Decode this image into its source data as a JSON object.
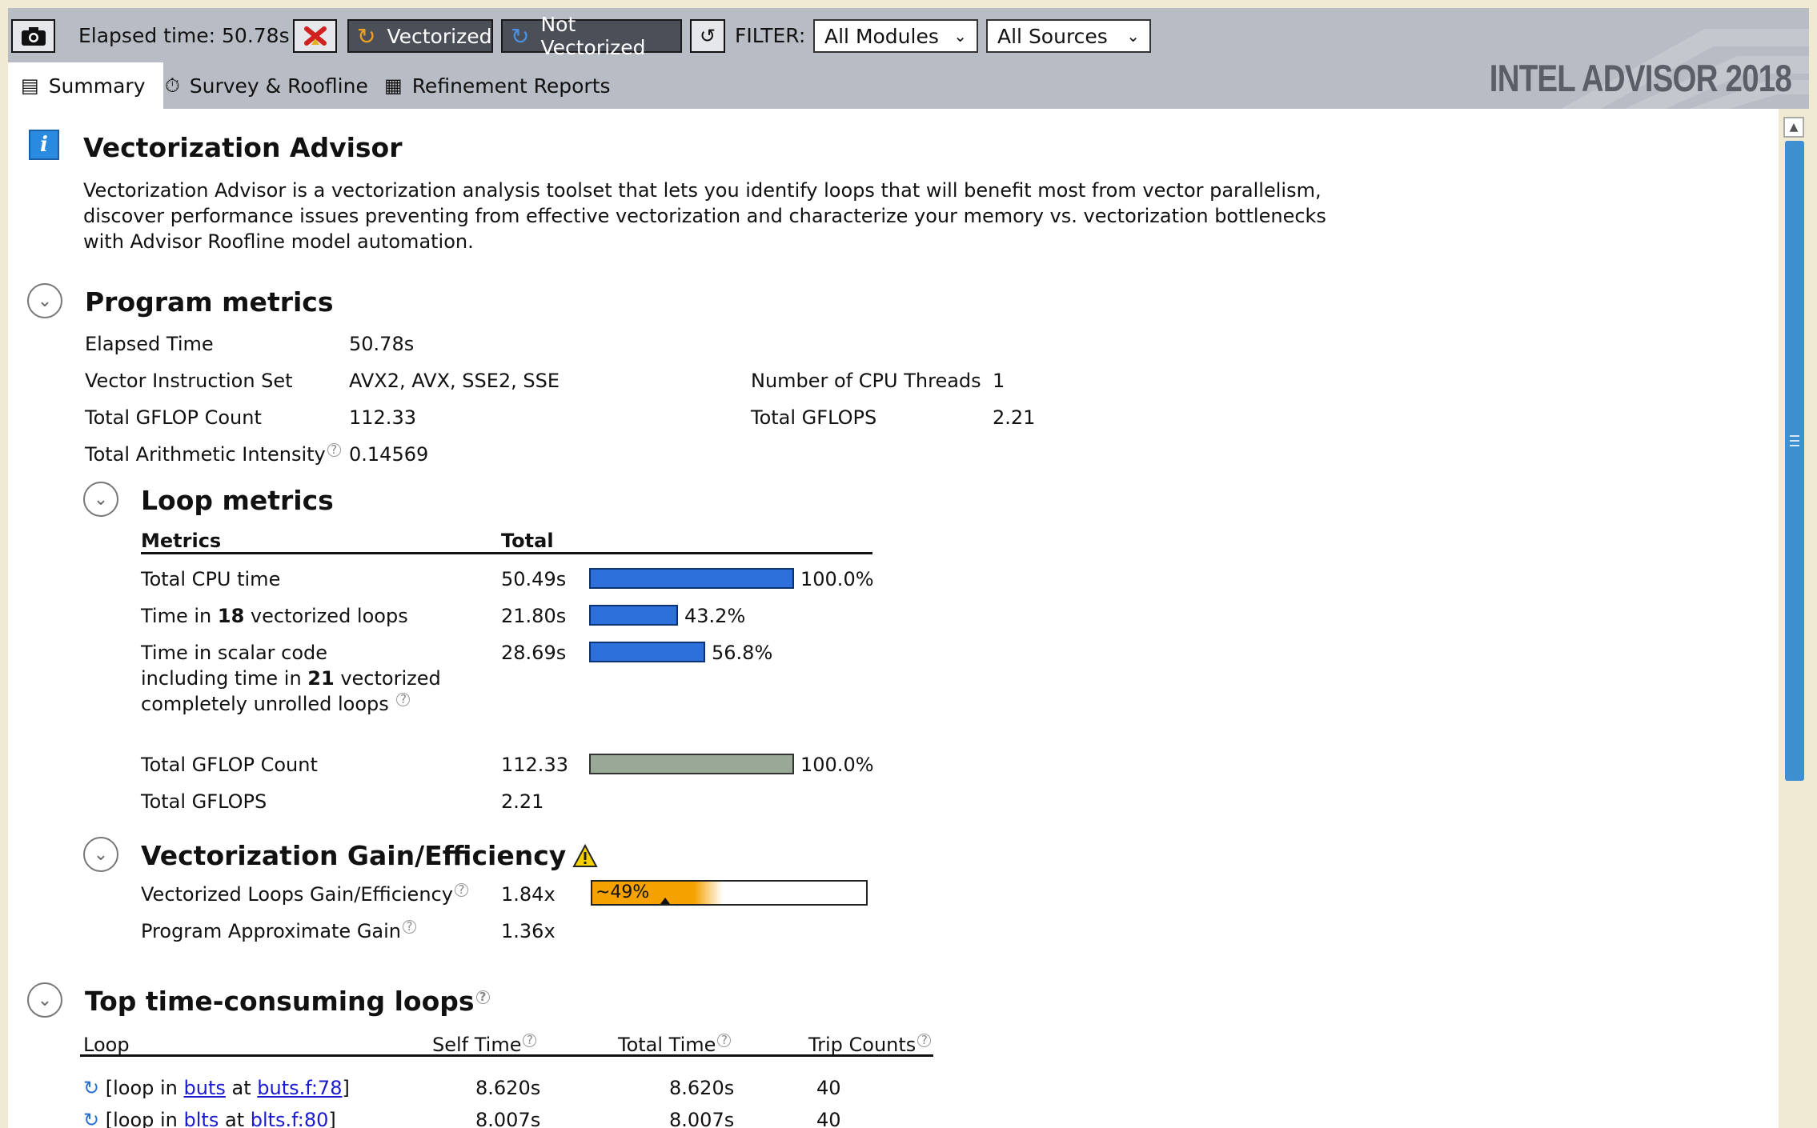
{
  "toolbar": {
    "elapsed_label": "Elapsed time: 50.78s",
    "vectorized_label": "Vectorized",
    "not_vectorized_label": "Not Vectorized",
    "filter_label": "FILTER:",
    "modules_value": "All Modules",
    "sources_value": "All Sources"
  },
  "brand": "INTEL ADVISOR 2018",
  "tabs": [
    {
      "label": "Summary",
      "active": true
    },
    {
      "label": "Survey & Roofline",
      "active": false
    },
    {
      "label": "Refinement Reports",
      "active": false
    }
  ],
  "intro": {
    "title": "Vectorization Advisor",
    "lines": [
      "Vectorization Advisor is a vectorization analysis toolset that lets you identify loops that will benefit most from vector parallelism,",
      "discover performance issues preventing from effective vectorization and characterize your memory vs. vectorization bottlenecks",
      "with Advisor Roofline model automation."
    ]
  },
  "program_metrics": {
    "title": "Program metrics",
    "elapsed_label": "Elapsed Time",
    "elapsed_value": "50.78s",
    "vis_label": "Vector Instruction Set",
    "vis_value": "AVX2, AVX, SSE2, SSE",
    "threads_label": "Number of CPU Threads",
    "threads_value": "1",
    "gflop_count_label": "Total GFLOP Count",
    "gflop_count_value": "112.33",
    "gflops_label": "Total GFLOPS",
    "gflops_value": "2.21",
    "ai_label": "Total Arithmetic Intensity",
    "ai_value": "0.14569"
  },
  "loop_metrics": {
    "title": "Loop metrics",
    "col_metrics": "Metrics",
    "col_total": "Total",
    "cpu_label": "Total CPU time",
    "cpu_value": "50.49s",
    "cpu_pct": "100.0%",
    "cpu_frac": 1.0,
    "vec_prefix": "Time in ",
    "vec_count": "18",
    "vec_suffix": " vectorized loops",
    "vec_value": "21.80s",
    "vec_pct": "43.2%",
    "vec_frac": 0.432,
    "scalar_line1": "Time in scalar code",
    "scalar_line2_prefix": "including time in ",
    "scalar_count": "21",
    "scalar_line2_suffix": " vectorized",
    "scalar_line3": "completely unrolled loops",
    "scalar_value": "28.69s",
    "scalar_pct": "56.8%",
    "scalar_frac": 0.568,
    "gflop_label": "Total GFLOP Count",
    "gflop_value": "112.33",
    "gflop_pct": "100.0%",
    "gflop_frac": 1.0,
    "gflops_label": "Total GFLOPS",
    "gflops_value": "2.21"
  },
  "gain": {
    "title": "Vectorization Gain/Efficiency",
    "vle_label": "Vectorized Loops Gain/Efficiency",
    "vle_value": "1.84x",
    "efficiency_label": "~49%",
    "efficiency_frac": 0.49,
    "pag_label": "Program Approximate Gain",
    "pag_value": "1.36x"
  },
  "top_loops": {
    "title": "Top time-consuming loops",
    "col_loop": "Loop",
    "col_self": "Self Time",
    "col_total": "Total Time",
    "col_trip": "Trip Counts",
    "rows": [
      {
        "prefix": "[loop in ",
        "func": "buts",
        "mid": " at ",
        "file": "buts.f:78",
        "suffix": "]",
        "self": "8.620s",
        "total": "8.620s",
        "trip": "40"
      },
      {
        "prefix": "[loop in ",
        "func": "blts",
        "mid": " at ",
        "file": "blts.f:80",
        "suffix": "]",
        "self": "8.007s",
        "total": "8.007s",
        "trip": "40"
      }
    ]
  },
  "colors": {
    "bar_blue": "#2d6fdb",
    "bar_green": "#9aa898",
    "gain_orange": "#f5a100",
    "link": "#1a1ad0"
  }
}
